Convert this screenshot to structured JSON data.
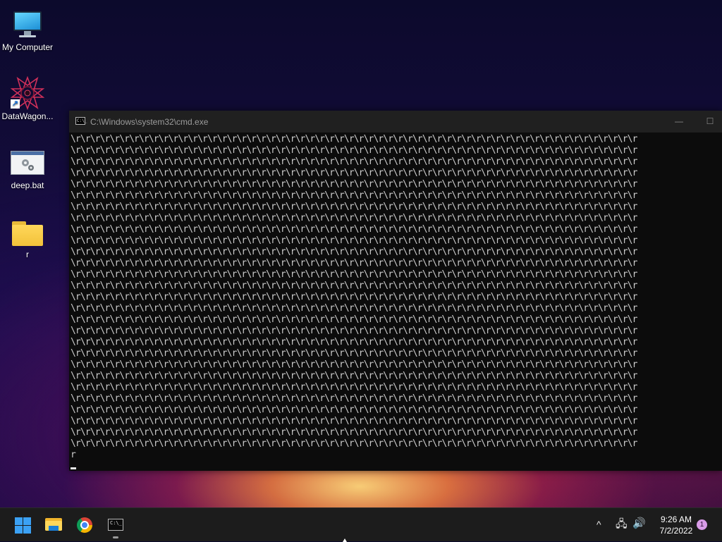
{
  "desktop": {
    "icons": [
      {
        "label": "My Computer",
        "icon": "monitor-icon"
      },
      {
        "label": "DataWagon...",
        "icon": "datawagon-star-icon"
      },
      {
        "label": "deep.bat",
        "icon": "batch-file-icon"
      },
      {
        "label": "r",
        "icon": "folder-icon"
      }
    ]
  },
  "cmd_window": {
    "title": "C:\\Windows\\system32\\cmd.exe",
    "minimize": "—",
    "maximize": "☐",
    "icon_text": "C:\\_",
    "output_repeat_unit": "\\r",
    "output_full_lines": 28,
    "output_repeats_per_line": 58,
    "output_last_line": "r"
  },
  "taskbar": {
    "apps": [
      "start-icon",
      "file-explorer-icon",
      "chrome-icon",
      "cmd-icon"
    ],
    "cmd_icon_text": "C:\\_",
    "tray": {
      "chevron": "^",
      "network": "🖧",
      "volume": "🔊"
    },
    "clock": {
      "time": "9:26 AM",
      "date": "7/2/2022"
    },
    "notification_count": "1"
  },
  "colors": {
    "terminal_bg": "#0c0c0c",
    "terminal_fg": "#cccccc",
    "titlebar_bg": "#202020",
    "taskbar_bg": "#1c1c1c",
    "windows_blue": "#3ba1f4",
    "notification_badge": "#d99ce8"
  }
}
